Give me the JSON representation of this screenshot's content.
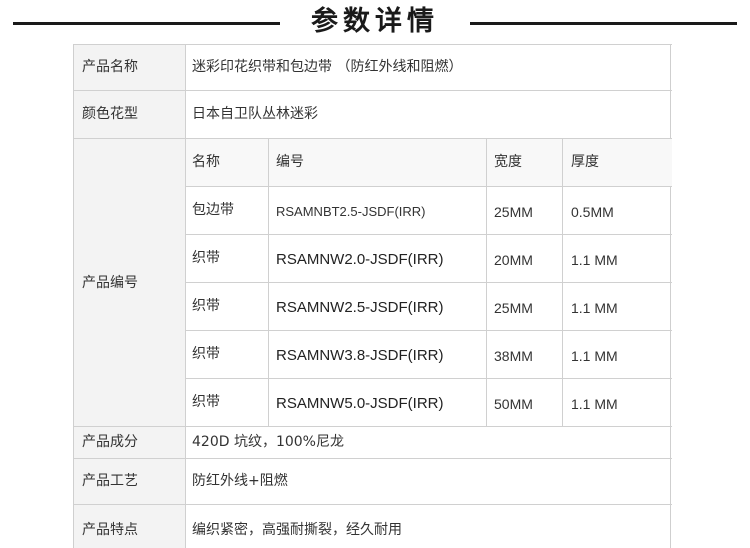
{
  "title": "参数详情",
  "rows": {
    "name": {
      "label": "产品名称",
      "value": "迷彩印花织带和包边带 （防红外线和阻燃）"
    },
    "pattern": {
      "label": "颜色花型",
      "value": "日本自卫队丛林迷彩"
    },
    "code": {
      "label": "产品编号",
      "headers": [
        "名称",
        "编号",
        "宽度",
        "厚度"
      ],
      "items": [
        {
          "name": "包边带",
          "code": "RSAMNBT2.5-JSDF(IRR)",
          "width": "25MM",
          "thickness": "0.5MM"
        },
        {
          "name": "织带",
          "code": "RSAMNW2.0-JSDF(IRR)",
          "width": "20MM",
          "thickness": "1.1 MM"
        },
        {
          "name": "织带",
          "code": "RSAMNW2.5-JSDF(IRR)",
          "width": "25MM",
          "thickness": "1.1 MM"
        },
        {
          "name": "织带",
          "code": "RSAMNW3.8-JSDF(IRR)",
          "width": "38MM",
          "thickness": "1.1 MM"
        },
        {
          "name": "织带",
          "code": "RSAMNW5.0-JSDF(IRR)",
          "width": "50MM",
          "thickness": "1.1 MM"
        }
      ]
    },
    "composition": {
      "label": "产品成分",
      "value": "420D 坑纹，100%尼龙"
    },
    "process": {
      "label": "产品工艺",
      "value": "防红外线+阻燃"
    },
    "features": {
      "label": "产品特点",
      "value": "编织紧密，高强耐撕裂，经久耐用"
    }
  }
}
